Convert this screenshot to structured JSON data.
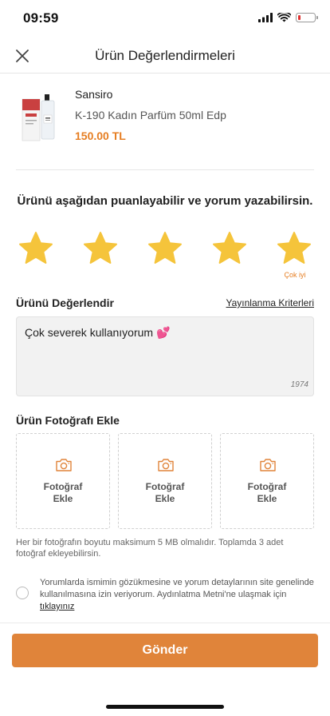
{
  "status_bar": {
    "time": "09:59",
    "battery_level": 0.2,
    "battery_color": "#e0302e"
  },
  "nav": {
    "title": "Ürün Değerlendirmeleri",
    "close_icon": "close-icon"
  },
  "product": {
    "brand": "Sansiro",
    "name": "K-190 Kadın Parfüm 50ml Edp",
    "price": "150.00 TL",
    "price_color": "#e67e22"
  },
  "rating": {
    "prompt": "Ürünü aşağıdan puanlayabilir ve yorum yazabilirsin.",
    "stars_selected": 5,
    "stars_total": 5,
    "star_color": "#f5c43b",
    "selected_caption": "Çok iyi"
  },
  "review": {
    "section_label": "Ürünü Değerlendir",
    "criteria_link": "Yayınlanma Kriterleri",
    "comment": "Çok severek kullanıyorum 💕",
    "remaining_chars": "1974"
  },
  "photos": {
    "section_label": "Ürün Fotoğrafı Ekle",
    "slots": [
      {
        "label": "Fotoğraf\nEkle"
      },
      {
        "label": "Fotoğraf\nEkle"
      },
      {
        "label": "Fotoğraf\nEkle"
      }
    ],
    "info": "Her bir fotoğrafın boyutu maksimum 5 MB olmalıdır. Toplamda 3 adet fotoğraf ekleyebilirsin."
  },
  "consent": {
    "text": "Yorumlarda ismimin gözükmesine ve yorum detaylarının site genelinde kullanılmasına izin veriyorum. Aydınlatma Metni'ne ulaşmak için ",
    "link": "tıklayınız",
    "checked": false
  },
  "submit": {
    "label": "Gönder",
    "color": "#e0843a"
  }
}
